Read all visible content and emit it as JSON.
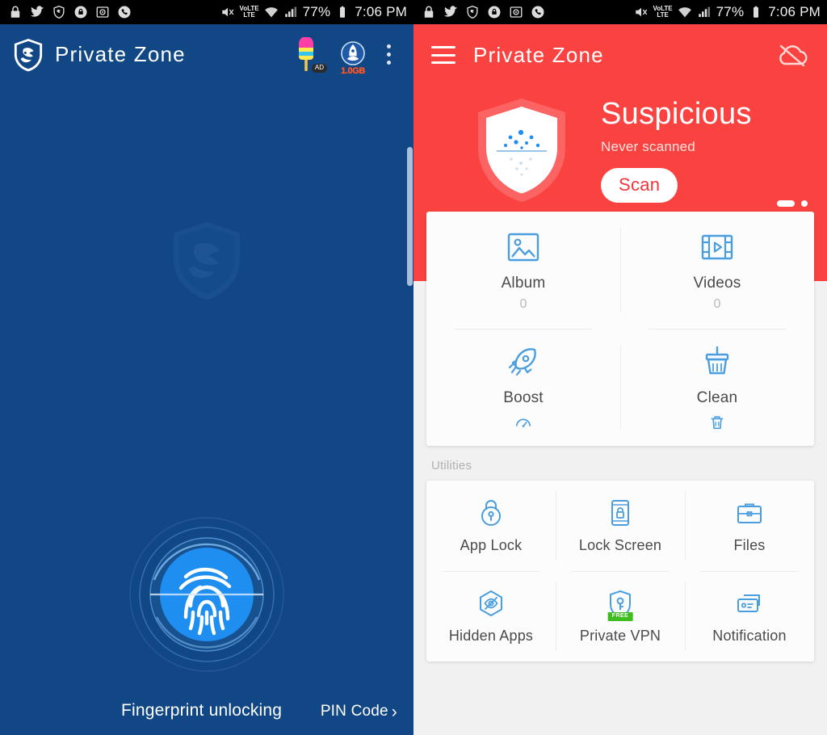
{
  "status_bar": {
    "left_icons": [
      "lock-icon",
      "twitter-icon",
      "shield-lion-icon",
      "lock-circle-icon",
      "safe-vault-icon",
      "phone-icon"
    ],
    "mute_icon": "volume-mute-icon",
    "network_label_top": "VoLTE",
    "network_label_bottom": "LTE",
    "wifi_icon": "wifi-icon",
    "signal_icon": "cell-signal-icon",
    "battery_percent": "77%",
    "battery_icon": "battery-icon",
    "time": "7:06 PM"
  },
  "left_panel": {
    "app_title": "Private Zone",
    "logo_icon": "shield-lion-logo",
    "actions": {
      "ad_icon": "popsicle-ad-icon",
      "ad_badge": "AD",
      "boost_icon": "rocket-boost-icon",
      "boost_badge": "1.0GB",
      "overflow_icon": "overflow-menu-icon"
    },
    "watermark_icon": "shield-lion-watermark",
    "fingerprint_icon": "fingerprint-icon",
    "unlock_label": "Fingerprint unlocking",
    "pin_link": "PIN Code",
    "pin_chevron": "›"
  },
  "right_panel": {
    "menu_icon": "hamburger-menu-icon",
    "app_title": "Private Zone",
    "cloud_icon": "cloud-off-icon",
    "hero": {
      "shield_icon": "shield-scan-icon",
      "status": "Suspicious",
      "subtitle": "Never scanned",
      "scan_button": "Scan",
      "page_indicator": {
        "active": 0,
        "count": 2
      }
    },
    "main_grid": [
      {
        "label": "Album",
        "count": "0",
        "icon": "image-icon",
        "sub_icon": ""
      },
      {
        "label": "Videos",
        "count": "0",
        "icon": "video-icon",
        "sub_icon": ""
      },
      {
        "label": "Boost",
        "count": "",
        "icon": "rocket-icon",
        "sub_icon": "speedometer-icon"
      },
      {
        "label": "Clean",
        "count": "",
        "icon": "broom-icon",
        "sub_icon": "trash-icon"
      }
    ],
    "utilities_title": "Utilities",
    "utilities": [
      {
        "label": "App Lock",
        "icon": "padlock-icon",
        "badge": ""
      },
      {
        "label": "Lock Screen",
        "icon": "phone-lock-icon",
        "badge": ""
      },
      {
        "label": "Files",
        "icon": "briefcase-icon",
        "badge": ""
      },
      {
        "label": "Hidden Apps",
        "icon": "hidden-eye-icon",
        "badge": ""
      },
      {
        "label": "Private VPN",
        "icon": "vpn-shield-icon",
        "badge": "FREE"
      },
      {
        "label": "Notification",
        "icon": "notification-card-icon",
        "badge": ""
      }
    ]
  },
  "colors": {
    "brand_blue": "#124785",
    "brand_red": "#fa4340",
    "icon_blue": "#4a9ee0",
    "free_green": "#3ebd1f",
    "ad_orange": "#ff5a2b"
  }
}
